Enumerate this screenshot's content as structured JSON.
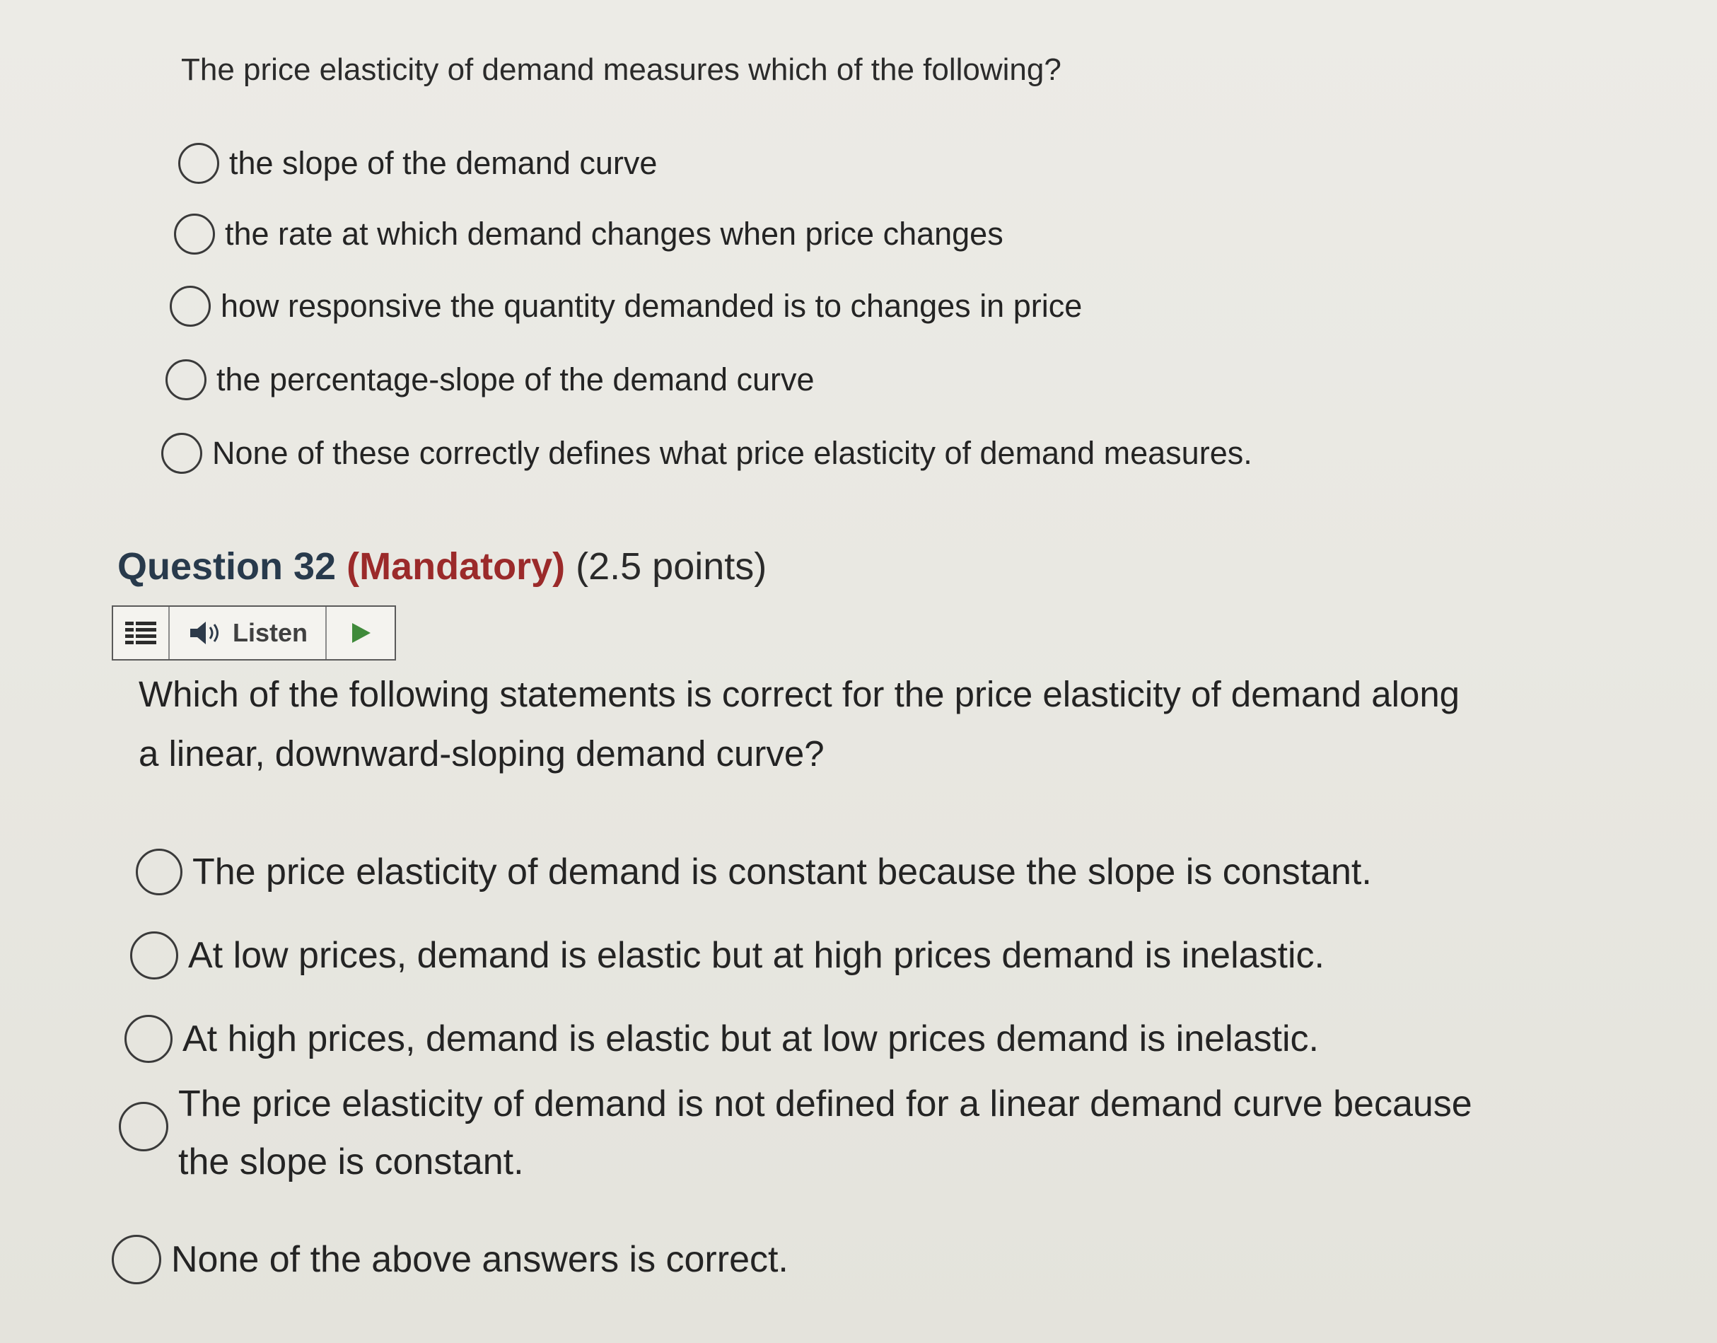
{
  "question_31": {
    "prompt": "The price elasticity of demand measures which of the following?",
    "options": [
      "the slope of the demand curve",
      "the rate at which demand changes when price changes",
      "how responsive the quantity demanded is to changes in price",
      "the percentage-slope of the demand curve",
      "None of these correctly defines what price elasticity of demand measures."
    ]
  },
  "question_32": {
    "number_label": "Question 32",
    "mandatory_label": "(Mandatory)",
    "points_label": "(2.5 points)",
    "listen_label": "Listen",
    "prompt_line1": "Which of the following statements is correct for the price elasticity of demand along",
    "prompt_line2": "a linear, downward-sloping demand curve?",
    "options": [
      "The price elasticity of demand is constant because the slope is constant.",
      "At low prices, demand is elastic but at high prices demand is inelastic.",
      "At high prices, demand is elastic but at low prices demand is inelastic.",
      "The price elasticity of demand is not defined for a linear demand curve because",
      "the slope is constant.",
      "None of the above answers is correct."
    ]
  },
  "colors": {
    "mandatory": "#9b2a2a",
    "question_number": "#283a4c",
    "play_icon": "#3f8a3a"
  },
  "icons": {
    "menu": "menu-lines-icon",
    "speaker": "speaker-icon",
    "play": "play-icon"
  }
}
